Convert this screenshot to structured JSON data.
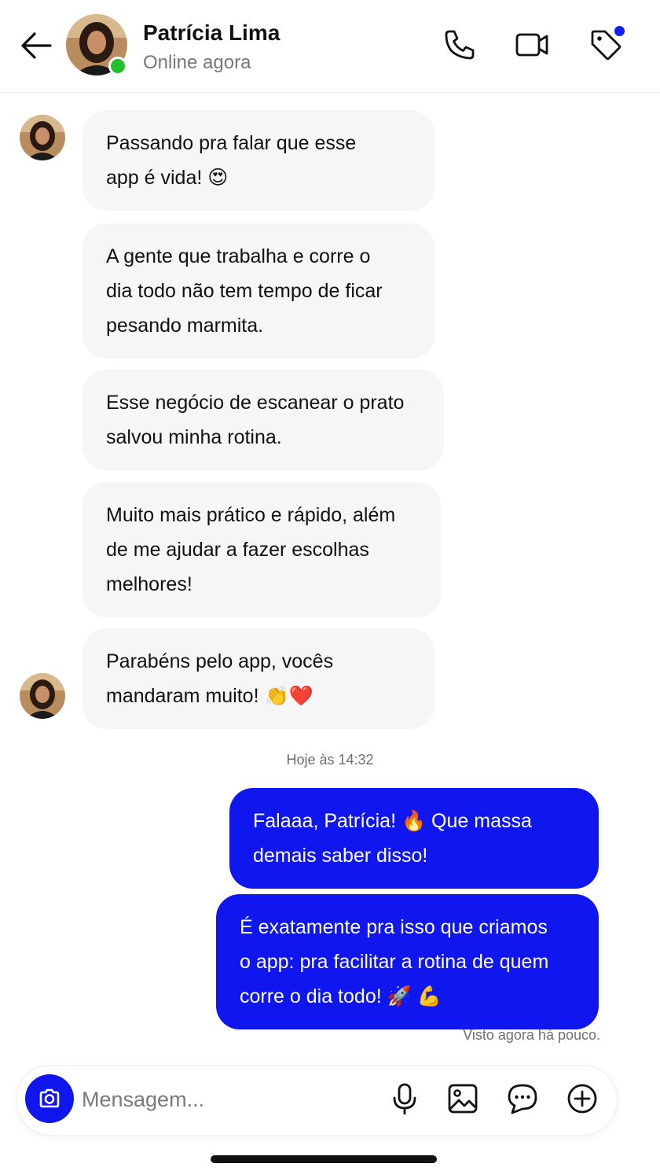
{
  "header": {
    "contact_name": "Patrícia Lima",
    "contact_status": "Online agora",
    "icons": [
      "back-arrow-icon",
      "phone-icon",
      "video-icon",
      "tag-icon"
    ]
  },
  "colors": {
    "accent": "#0f16ee",
    "incoming_bubble": "#f6f6f7",
    "online": "#22c12b"
  },
  "messages": {
    "incoming": [
      {
        "line1": "Passando pra falar que esse",
        "line2": "app é vida! 😍"
      },
      {
        "line1": "A gente que trabalha e corre o",
        "line2": "dia todo não tem tempo de ficar",
        "line3": "pesando marmita."
      },
      {
        "line1": "Esse negócio de escanear o prato",
        "line2": "salvou minha rotina."
      },
      {
        "line1": "Muito mais prático e rápido, além",
        "line2": "de me ajudar a fazer escolhas",
        "line3": "melhores!"
      },
      {
        "line1": "Parabéns pelo app, vocês",
        "line2": "mandaram muito! 👏❤️"
      }
    ],
    "timestamp": "Hoje às 14:32",
    "outgoing": [
      {
        "line1": "Falaaa, Patrícia! 🔥 Que massa",
        "line2": "demais saber disso!"
      },
      {
        "line1": "É exatamente pra isso que criamos",
        "line2": "o app: pra facilitar a rotina de quem",
        "line3": "corre o dia todo! 🚀 💪"
      }
    ],
    "seen_status": "Visto agora há pouco."
  },
  "composer": {
    "placeholder": "Mensagem...",
    "icons": [
      "camera-icon",
      "microphone-icon",
      "image-icon",
      "chat-bubble-icon",
      "plus-circle-icon"
    ]
  }
}
